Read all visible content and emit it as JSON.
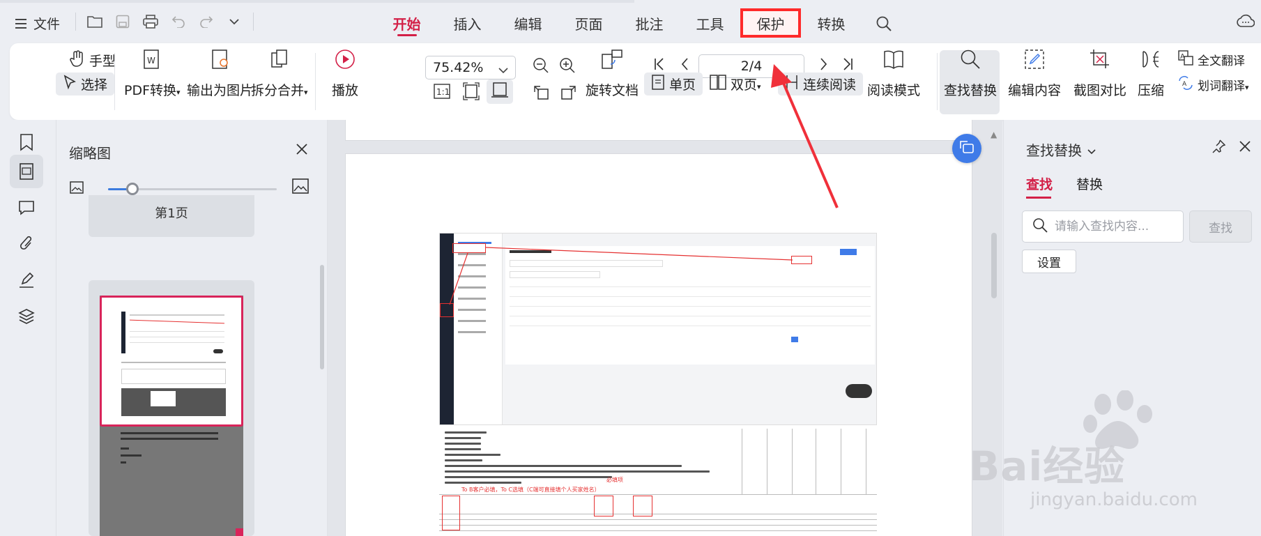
{
  "menubar": {
    "file_label": "文件",
    "tabs": [
      {
        "label": "开始",
        "active": true
      },
      {
        "label": "插入"
      },
      {
        "label": "编辑"
      },
      {
        "label": "页面"
      },
      {
        "label": "批注"
      },
      {
        "label": "工具"
      },
      {
        "label": "保护",
        "highlighted": true
      },
      {
        "label": "转换"
      }
    ]
  },
  "ribbon": {
    "hand_tool": "手型",
    "select_tool": "选择",
    "pdf_convert": "PDF转换",
    "export_image": "输出为图片",
    "split_merge": "拆分合并",
    "play": "播放",
    "zoom_value": "75.42%",
    "rotate_doc": "旋转文档",
    "page_value": "2/4",
    "single_page": "单页",
    "double_page": "双页",
    "continuous": "连续阅读",
    "read_mode": "阅读模式",
    "find_replace": "查找替换",
    "edit_content": "编辑内容",
    "screenshot_compare": "截图对比",
    "compress": "压缩",
    "full_translate": "全文翻译",
    "word_translate": "划词翻译"
  },
  "thumbnails": {
    "title": "缩略图",
    "page1_label": "第1页"
  },
  "find_panel": {
    "title": "查找替换",
    "tab_find": "查找",
    "tab_replace": "替换",
    "search_placeholder": "请输入查找内容...",
    "find_button": "查找",
    "settings_button": "设置"
  },
  "embedded_doc": {
    "red_label_1": "To B客户必填，To C选填（C端可直接填个人买家姓名）",
    "red_label_2": "必填项"
  },
  "watermark": {
    "brand": "Bai经验",
    "url": "jingyan.baidu.com"
  },
  "colors": {
    "accent": "#d32047",
    "highlight_red": "#ff2a2a",
    "float_button": "#3f7be8"
  }
}
